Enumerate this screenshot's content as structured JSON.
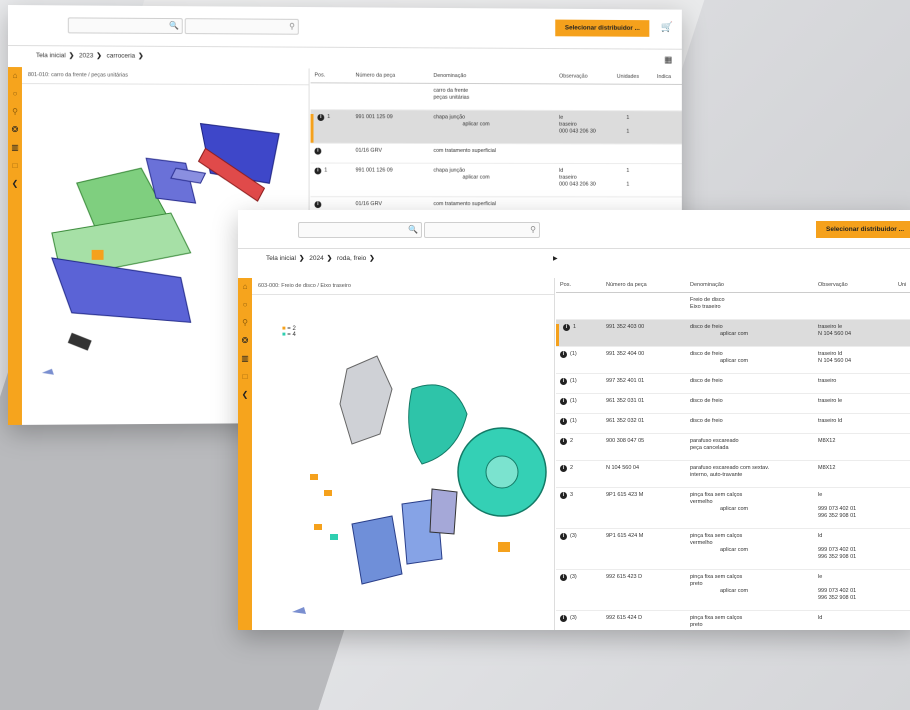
{
  "win1": {
    "search_placeholder": "",
    "dist_button": "Selecionar distribuidor ...",
    "breadcrumb": [
      "Tela inicial",
      "2023",
      "carroceria"
    ],
    "pane_title": "801-010: carro da frente / peças unitárias",
    "columns": [
      "Pos.",
      "Número da peça",
      "Denominação",
      "Observação",
      "Unidades",
      "Indica"
    ],
    "rows": [
      {
        "info": false,
        "pos": "",
        "part": "",
        "name": [
          "carro da frente",
          "peças unitárias"
        ],
        "obs": [],
        "units": [],
        "sel": false
      },
      {
        "info": true,
        "pos": "1",
        "part": "991 001 125 09",
        "name": [
          "chapa junção",
          "aplicar com"
        ],
        "obs": [
          "le",
          "traseiro",
          "000 043 206 30"
        ],
        "units": [
          "1",
          "",
          "1"
        ],
        "sel": true
      },
      {
        "info": true,
        "pos": "",
        "part": "01/16    GRV",
        "name": [
          "com tratamento superficial"
        ],
        "obs": [],
        "units": [],
        "sel": false
      },
      {
        "info": true,
        "pos": "1",
        "part": "991 001 126 09",
        "name": [
          "chapa junção",
          "aplicar com"
        ],
        "obs": [
          "ld",
          "traseiro",
          "000 043 206 30"
        ],
        "units": [
          "1",
          "",
          "1"
        ],
        "sel": false
      },
      {
        "info": true,
        "pos": "",
        "part": "01/16    GRV",
        "name": [
          "com tratamento superficial"
        ],
        "obs": [],
        "units": [],
        "sel": false
      }
    ]
  },
  "win2": {
    "search_placeholder": "",
    "dist_button": "Selecionar distribuidor ...",
    "breadcrumb": [
      "Tela inicial",
      "2024",
      "roda, freio"
    ],
    "pane_title": "603-000: Freio de disco / Eixo traseiro",
    "legend": [
      "= 2",
      "= 4"
    ],
    "columns": [
      "Pos.",
      "Número da peça",
      "Denominação",
      "Observação",
      "Uni"
    ],
    "rows": [
      {
        "info": false,
        "pos": "",
        "part": "",
        "name": [
          "Freio de disco",
          "Eixo traseiro"
        ],
        "obs": [],
        "sel": false
      },
      {
        "info": true,
        "pos": "1",
        "part": "991 352 403 00",
        "name": [
          "disco de freio",
          "aplicar com"
        ],
        "obs": [
          "traseiro  le",
          "N  104 560 04"
        ],
        "sel": true
      },
      {
        "info": true,
        "pos": "(1)",
        "part": "991 352 404 00",
        "name": [
          "disco de freio",
          "aplicar com"
        ],
        "obs": [
          "traseiro ld",
          "N  104 560 04"
        ],
        "sel": false
      },
      {
        "info": true,
        "pos": "(1)",
        "part": "997 352 401 01",
        "name": [
          "disco de freio"
        ],
        "obs": [
          "traseiro"
        ],
        "sel": false
      },
      {
        "info": true,
        "pos": "(1)",
        "part": "961 352 031 01",
        "name": [
          "disco de freio"
        ],
        "obs": [
          "traseiro  le"
        ],
        "sel": false
      },
      {
        "info": true,
        "pos": "(1)",
        "part": "961 352 032 01",
        "name": [
          "disco de freio"
        ],
        "obs": [
          "traseiro ld"
        ],
        "sel": false
      },
      {
        "info": true,
        "pos": "2",
        "part": "900 308 047 05",
        "name": [
          "parafuso escareado",
          "peça cancelada"
        ],
        "obs": [
          "M8X12"
        ],
        "sel": false
      },
      {
        "info": true,
        "pos": "2",
        "part": "N  104 560 04",
        "name": [
          "parafuso escareado com sextav.",
          "interno, auto-travante"
        ],
        "obs": [
          "M8X12"
        ],
        "sel": false
      },
      {
        "info": true,
        "pos": "3",
        "part": "9P1 615 423 M",
        "name": [
          "pinça fixa sem calços",
          "vermelho",
          "aplicar com"
        ],
        "obs": [
          "le",
          "",
          "999 073 402 01",
          "996 352 908 01"
        ],
        "sel": false
      },
      {
        "info": true,
        "pos": "(3)",
        "part": "9P1 615 424 M",
        "name": [
          "pinça fixa sem calços",
          "vermelho",
          "aplicar com"
        ],
        "obs": [
          "ld",
          "",
          "999 073 402 01",
          "996 352 908 01"
        ],
        "sel": false
      },
      {
        "info": true,
        "pos": "(3)",
        "part": "992 615 423 D",
        "name": [
          "pinça fixa sem calços",
          "preto",
          "aplicar com"
        ],
        "obs": [
          "le",
          "",
          "999 073 402 01",
          "996 352 908 01"
        ],
        "sel": false
      },
      {
        "info": true,
        "pos": "(3)",
        "part": "992 615 424 D",
        "name": [
          "pinça fixa sem calços",
          "preto"
        ],
        "obs": [
          "ld"
        ],
        "sel": false
      }
    ]
  },
  "colors": {
    "accent": "#f5a11c",
    "sidebar": "#f6a41d",
    "selected_row": "#dcdcdc"
  },
  "icons": [
    "home-icon",
    "car-icon",
    "search-icon",
    "steering-wheel-icon",
    "cart-icon",
    "document-icon",
    "share-icon",
    "magnifier-icon"
  ]
}
